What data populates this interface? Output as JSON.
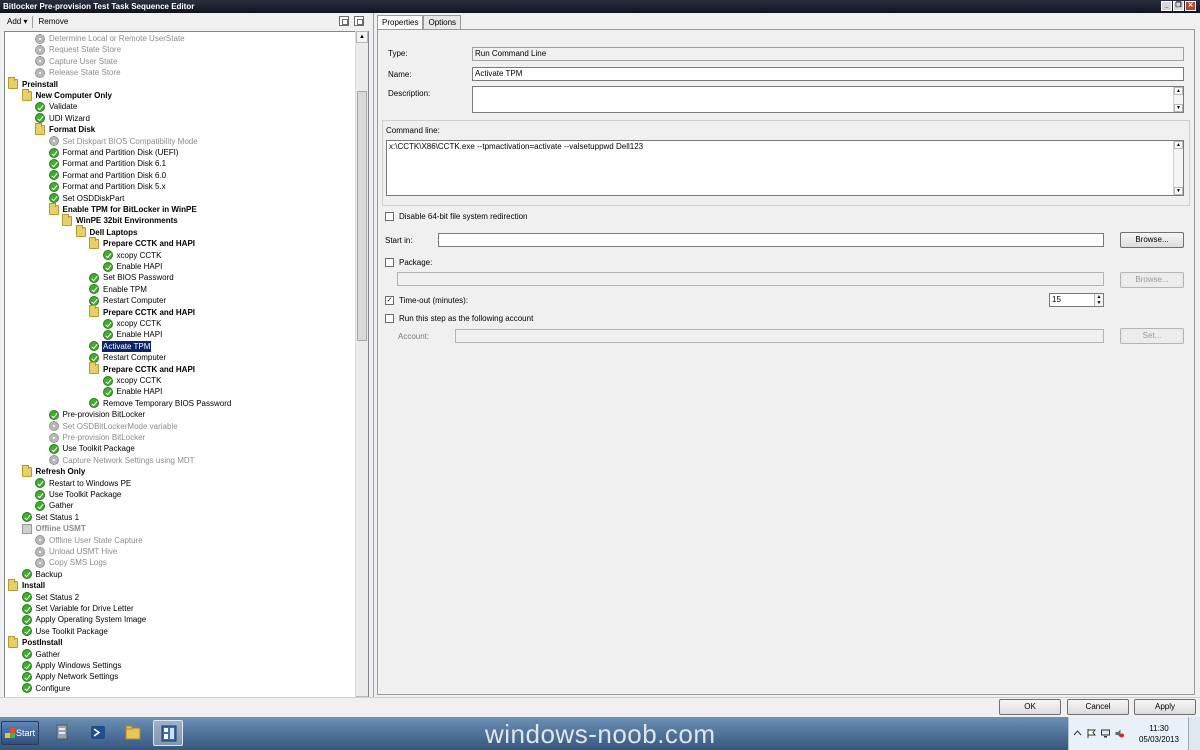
{
  "window": {
    "title": "Bitlocker Pre-provision Test Task Sequence Editor"
  },
  "toolbar": {
    "add_label": "Add",
    "remove_label": "Remove"
  },
  "tree": [
    {
      "label": "Determine Local or Remote UserState",
      "icon": "gear",
      "state": "disabled",
      "indent": 3
    },
    {
      "label": "Request State Store",
      "icon": "gear",
      "state": "disabled",
      "indent": 3
    },
    {
      "label": "Capture User State",
      "icon": "gear",
      "state": "disabled",
      "indent": 3
    },
    {
      "label": "Release State Store",
      "icon": "gear",
      "state": "disabled",
      "indent": 3
    },
    {
      "label": "Preinstall",
      "icon": "folder",
      "state": "group",
      "indent": 1
    },
    {
      "label": "New Computer Only",
      "icon": "folder",
      "state": "group",
      "indent": 2
    },
    {
      "label": "Validate",
      "icon": "check",
      "state": "",
      "indent": 3
    },
    {
      "label": "UDI Wizard",
      "icon": "check",
      "state": "",
      "indent": 3
    },
    {
      "label": "Format Disk",
      "icon": "folder",
      "state": "group",
      "indent": 3
    },
    {
      "label": "Set Diskpart BIOS Compatibility Mode",
      "icon": "gear",
      "state": "disabled",
      "indent": 4
    },
    {
      "label": "Format and Partition Disk (UEFI)",
      "icon": "check",
      "state": "",
      "indent": 4
    },
    {
      "label": "Format and Partition Disk 6.1",
      "icon": "check",
      "state": "",
      "indent": 4
    },
    {
      "label": "Format and Partition Disk 6.0",
      "icon": "check",
      "state": "",
      "indent": 4
    },
    {
      "label": "Format and Partition Disk 5.x",
      "icon": "check",
      "state": "",
      "indent": 4
    },
    {
      "label": "Set OSDDiskPart",
      "icon": "check",
      "state": "",
      "indent": 4
    },
    {
      "label": "Enable TPM for BitLocker in WinPE",
      "icon": "folder",
      "state": "group",
      "indent": 4
    },
    {
      "label": "WinPE 32bit Environments",
      "icon": "folder",
      "state": "group",
      "indent": 5
    },
    {
      "label": "Dell Laptops",
      "icon": "folder",
      "state": "group",
      "indent": 6
    },
    {
      "label": "Prepare CCTK and HAPI",
      "icon": "folder",
      "state": "group",
      "indent": 7
    },
    {
      "label": "xcopy CCTK",
      "icon": "check",
      "state": "",
      "indent": 8
    },
    {
      "label": "Enable HAPI",
      "icon": "check",
      "state": "",
      "indent": 8
    },
    {
      "label": "Set BIOS Password",
      "icon": "check",
      "state": "",
      "indent": 7
    },
    {
      "label": "Enable TPM",
      "icon": "check",
      "state": "",
      "indent": 7
    },
    {
      "label": "Restart Computer",
      "icon": "check",
      "state": "",
      "indent": 7
    },
    {
      "label": "Prepare CCTK and HAPI",
      "icon": "folder",
      "state": "group",
      "indent": 7
    },
    {
      "label": "xcopy CCTK",
      "icon": "check",
      "state": "",
      "indent": 8
    },
    {
      "label": "Enable HAPI",
      "icon": "check",
      "state": "",
      "indent": 8
    },
    {
      "label": "Activate TPM",
      "icon": "check",
      "state": "selected",
      "indent": 7
    },
    {
      "label": "Restart Computer",
      "icon": "check",
      "state": "",
      "indent": 7
    },
    {
      "label": "Prepare CCTK and HAPI",
      "icon": "folder",
      "state": "group",
      "indent": 7
    },
    {
      "label": "xcopy CCTK",
      "icon": "check",
      "state": "",
      "indent": 8
    },
    {
      "label": "Enable HAPI",
      "icon": "check",
      "state": "",
      "indent": 8
    },
    {
      "label": "Remove Temporary BIOS Password",
      "icon": "check",
      "state": "",
      "indent": 7
    },
    {
      "label": "Pre-provision BitLocker",
      "icon": "check",
      "state": "",
      "indent": 4
    },
    {
      "label": "Set OSDBitLockerMode variable",
      "icon": "gear",
      "state": "disabled",
      "indent": 4
    },
    {
      "label": "Pre-provision BitLocker",
      "icon": "gear",
      "state": "disabled",
      "indent": 4
    },
    {
      "label": "Use Toolkit Package",
      "icon": "check",
      "state": "",
      "indent": 4
    },
    {
      "label": "Capture Network Settings using MDT",
      "icon": "gear",
      "state": "disabled",
      "indent": 4
    },
    {
      "label": "Refresh Only",
      "icon": "folder",
      "state": "group",
      "indent": 2
    },
    {
      "label": "Restart to Windows PE",
      "icon": "check",
      "state": "",
      "indent": 3
    },
    {
      "label": "Use Toolkit Package",
      "icon": "check",
      "state": "",
      "indent": 3
    },
    {
      "label": "Gather",
      "icon": "check",
      "state": "",
      "indent": 3
    },
    {
      "label": "Set Status 1",
      "icon": "check",
      "state": "",
      "indent": 2
    },
    {
      "label": "Offline USMT",
      "icon": "dfolder",
      "state": "group-disabled",
      "indent": 2
    },
    {
      "label": "Offline User State Capture",
      "icon": "gear",
      "state": "disabled",
      "indent": 3
    },
    {
      "label": "Unload USMT Hive",
      "icon": "gear",
      "state": "disabled",
      "indent": 3
    },
    {
      "label": "Copy SMS Logs",
      "icon": "gear",
      "state": "disabled",
      "indent": 3
    },
    {
      "label": "Backup",
      "icon": "check",
      "state": "",
      "indent": 2
    },
    {
      "label": "Install",
      "icon": "folder",
      "state": "group",
      "indent": 1
    },
    {
      "label": "Set Status 2",
      "icon": "check",
      "state": "",
      "indent": 2
    },
    {
      "label": "Set Variable for Drive Letter",
      "icon": "check",
      "state": "",
      "indent": 2
    },
    {
      "label": "Apply Operating System Image",
      "icon": "check",
      "state": "",
      "indent": 2
    },
    {
      "label": "Use Toolkit Package",
      "icon": "check",
      "state": "",
      "indent": 2
    },
    {
      "label": "PostInstall",
      "icon": "folder",
      "state": "group",
      "indent": 1
    },
    {
      "label": "Gather",
      "icon": "check",
      "state": "",
      "indent": 2
    },
    {
      "label": "Apply Windows Settings",
      "icon": "check",
      "state": "",
      "indent": 2
    },
    {
      "label": "Apply Network Settings",
      "icon": "check",
      "state": "",
      "indent": 2
    },
    {
      "label": "Configure",
      "icon": "check",
      "state": "",
      "indent": 2
    }
  ],
  "tabs": {
    "properties": "Properties",
    "options": "Options"
  },
  "props": {
    "type_label": "Type:",
    "type_value": "Run Command Line",
    "name_label": "Name:",
    "name_value": "Activate TPM",
    "description_label": "Description:",
    "description_value": "",
    "command_label": "Command line:",
    "command_value": "x:\\CCTK\\X86\\CCTK.exe --tpmactivation=activate --valsetuppwd Dell123",
    "disable64_label": "Disable 64-bit file system redirection",
    "startin_label": "Start in:",
    "startin_value": "",
    "browse_label": "Browse...",
    "package_label": "Package:",
    "package_value": "",
    "package_browse_label": "Browse...",
    "timeout_label": "Time-out (minutes):",
    "timeout_value": "15",
    "runas_label": "Run this step as the following account",
    "account_label": "Account:",
    "account_value": "",
    "set_label": "Set..."
  },
  "dialog": {
    "ok_label": "OK",
    "cancel_label": "Cancel",
    "apply_label": "Apply"
  },
  "taskbar": {
    "start_label": "Start",
    "watermark": "windows-noob.com",
    "clock_time": "11:30",
    "clock_date": "05/03/2013"
  }
}
